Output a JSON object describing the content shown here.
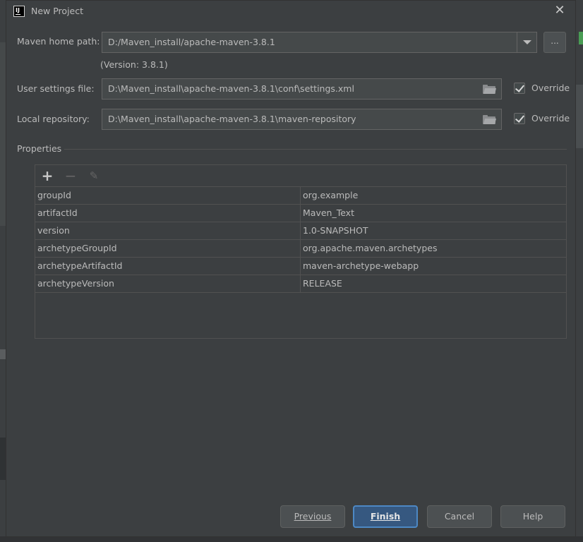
{
  "window": {
    "title": "New Project",
    "app_icon_text": "IJ"
  },
  "maven_home": {
    "label": "Maven home path:",
    "value": "D:/Maven_install/apache-maven-3.8.1",
    "version_note": "(Version: 3.8.1)",
    "browse_label": "..."
  },
  "user_settings": {
    "label": "User settings file:",
    "value": "D:\\Maven_install\\apache-maven-3.8.1\\conf\\settings.xml",
    "override_label": "Override",
    "override_checked": true
  },
  "local_repo": {
    "label": "Local repository:",
    "value": "D:\\Maven_install\\apache-maven-3.8.1\\maven-repository",
    "override_label": "Override",
    "override_checked": true
  },
  "properties": {
    "section_label": "Properties",
    "toolbar": {
      "add": "+",
      "remove": "−",
      "edit": "✎"
    },
    "rows": [
      {
        "key": "groupId",
        "value": "org.example"
      },
      {
        "key": "artifactId",
        "value": "Maven_Text"
      },
      {
        "key": "version",
        "value": "1.0-SNAPSHOT"
      },
      {
        "key": "archetypeGroupId",
        "value": "org.apache.maven.archetypes"
      },
      {
        "key": "archetypeArtifactId",
        "value": "maven-archetype-webapp"
      },
      {
        "key": "archetypeVersion",
        "value": "RELEASE"
      }
    ]
  },
  "buttons": {
    "previous": "Previous",
    "finish": "Finish",
    "cancel": "Cancel",
    "help": "Help"
  },
  "colors": {
    "dialog_bg": "#3c3f41",
    "field_bg": "#45494a",
    "primary_button": "#365880",
    "primary_border": "#4d88c4",
    "text": "#bbbbbb"
  }
}
